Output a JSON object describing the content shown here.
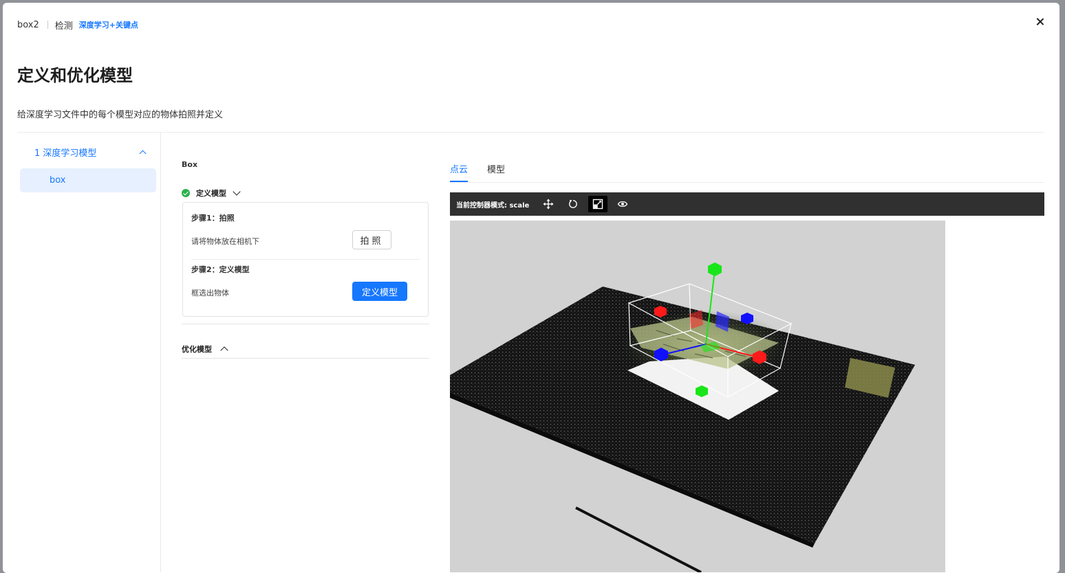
{
  "header": {
    "project_name": "box2",
    "mode": "检测",
    "algorithm": "深度学习+关键点"
  },
  "page": {
    "title": "定义和优化模型",
    "subtitle": "给深度学习文件中的每个模型对应的物体拍照并定义"
  },
  "sidebar": {
    "group_label": "1 深度学习模型",
    "items": [
      {
        "label": "box"
      }
    ]
  },
  "object": {
    "name": "Box",
    "define_section": {
      "label": "定义模型",
      "status": "completed",
      "step1": {
        "title": "步骤1：拍照",
        "desc": "请将物体放在相机下",
        "button": "拍照"
      },
      "step2": {
        "title": "步骤2：定义模型",
        "desc": "框选出物体",
        "button": "定义模型"
      }
    },
    "optimize_section": {
      "label": "优化模型"
    }
  },
  "viewer": {
    "tabs": [
      {
        "label": "点云",
        "active": true
      },
      {
        "label": "模型",
        "active": false
      }
    ],
    "toolbar": {
      "mode_label": "当前控制器模式:",
      "mode_value": "scale",
      "tools": [
        "move-icon",
        "rotate-icon",
        "scale-icon",
        "eye-icon"
      ],
      "active_tool": "scale-icon"
    }
  },
  "colors": {
    "accent": "#1677ff",
    "success": "#2bb24c",
    "toolbar_bg": "#303030",
    "viewport_bg": "#d2d2d2",
    "axis_x": "#ff1a1a",
    "axis_y": "#19e619",
    "axis_z": "#1010ff"
  }
}
